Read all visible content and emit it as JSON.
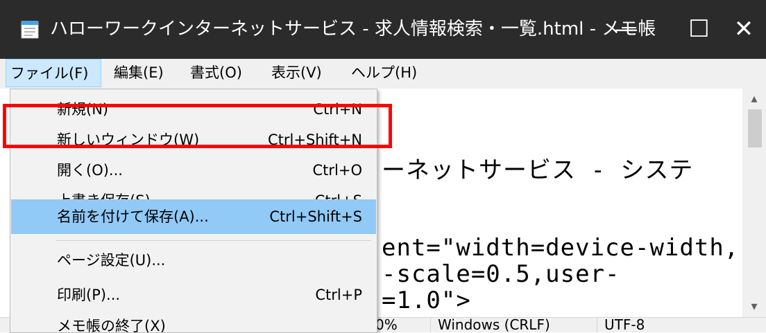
{
  "window": {
    "title": "ハローワークインターネットサービス - 求人情報検索・一覧.html - メモ帳",
    "minimize": "—",
    "maximize": "☐",
    "close": "✕"
  },
  "menubar": {
    "file": "ファイル(F)",
    "edit": "編集(E)",
    "format": "書式(O)",
    "view": "表示(V)",
    "help": "ヘルプ(H)"
  },
  "file_menu": {
    "new": {
      "label": "新規(N)",
      "shortcut": "Ctrl+N"
    },
    "new_window": {
      "label": "新しいウィンドウ(W)",
      "shortcut": "Ctrl+Shift+N"
    },
    "open": {
      "label": "開く(O)...",
      "shortcut": "Ctrl+O"
    },
    "save": {
      "label": "上書き保存(S)",
      "shortcut": "Ctrl+S"
    },
    "save_as": {
      "label": "名前を付けて保存(A)...",
      "shortcut": "Ctrl+Shift+S"
    },
    "page_setup": {
      "label": "ページ設定(U)..."
    },
    "print": {
      "label": "印刷(P)...",
      "shortcut": "Ctrl+P"
    },
    "exit": {
      "label": "メモ帳の終了(X)"
    }
  },
  "editor": {
    "lines": [
      "ーネットサービス - システ",
      "ent=\"width=device-width,",
      "-scale=0.5,user-",
      "=1.0\">"
    ]
  },
  "statusbar": {
    "zoom": "0%",
    "line_ending": "Windows (CRLF)",
    "encoding": "UTF-8"
  },
  "icons": {
    "app": "notepad-icon",
    "scroll_up": "chevron-up-icon",
    "scroll_down": "chevron-down-icon"
  },
  "colors": {
    "titlebar": "#2b2b2b",
    "menu_active": "#cce8ff",
    "item_highlight": "#91c9f7",
    "annotation": "#ff0000"
  }
}
